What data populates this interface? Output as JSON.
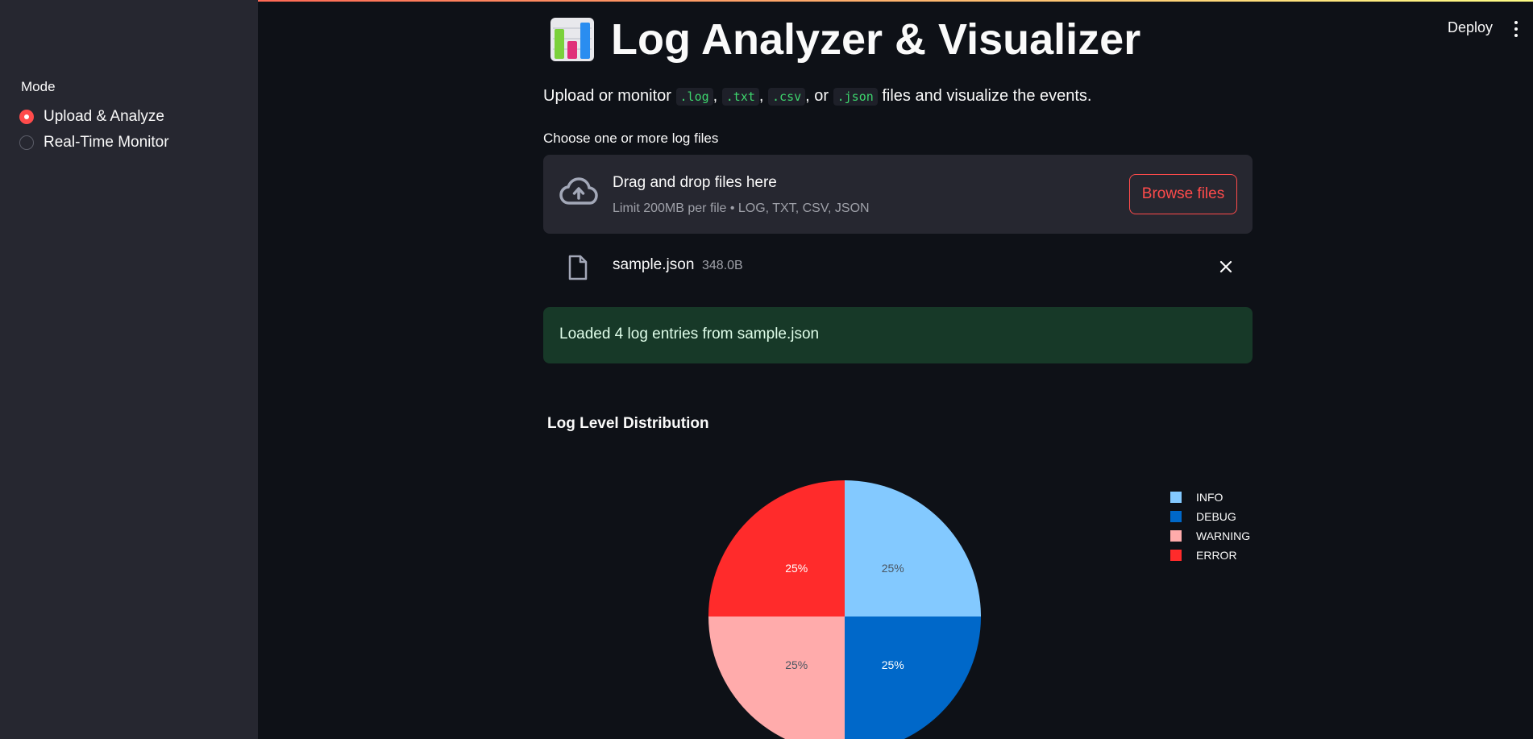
{
  "sidebar": {
    "mode_label": "Mode",
    "options": [
      {
        "label": "Upload & Analyze",
        "checked": true
      },
      {
        "label": "Real-Time Monitor",
        "checked": false
      }
    ]
  },
  "toolbar": {
    "deploy_label": "Deploy",
    "menu_icon": "more-vertical-icon"
  },
  "header": {
    "title_icon": "bar-chart-emoji-icon",
    "title": "Log Analyzer & Visualizer"
  },
  "subtitle": {
    "prefix": "Upload or monitor",
    "ext1": ".log",
    "ext2": ".txt",
    "ext3": ".csv",
    "ext4": ".json",
    "sep1": ",",
    "sep2": ",",
    "sep3": ", or",
    "suffix": "files and visualize the events."
  },
  "uploader": {
    "label": "Choose one or more log files",
    "drop_title": "Drag and drop files here",
    "drop_sub": "Limit 200MB per file • LOG, TXT, CSV, JSON",
    "browse_label": "Browse files",
    "icon": "cloud-upload-icon"
  },
  "file": {
    "name": "sample.json",
    "size": "348.0B",
    "icon": "file-icon",
    "remove_icon": "close-icon"
  },
  "success": {
    "message": "Loaded 4 log entries from sample.json",
    "color": "#173928"
  },
  "chart_title": "Log Level Distribution",
  "chart_data": {
    "type": "pie",
    "title": "",
    "labels": [
      "INFO",
      "DEBUG",
      "WARNING",
      "ERROR"
    ],
    "values": [
      1,
      1,
      1,
      1
    ],
    "percent_labels": [
      "25%",
      "25%",
      "25%",
      "25%"
    ],
    "colors": [
      "#83c9ff",
      "#0068c9",
      "#ffabab",
      "#ff2b2b"
    ],
    "label_colors": [
      "#4a5560",
      "#ffffff",
      "#4a5560",
      "#ffffff"
    ],
    "legend_position": "top-right"
  },
  "colors": {
    "background": "#0e1117",
    "sidebar": "#262730",
    "accent": "#ff4b4b"
  }
}
